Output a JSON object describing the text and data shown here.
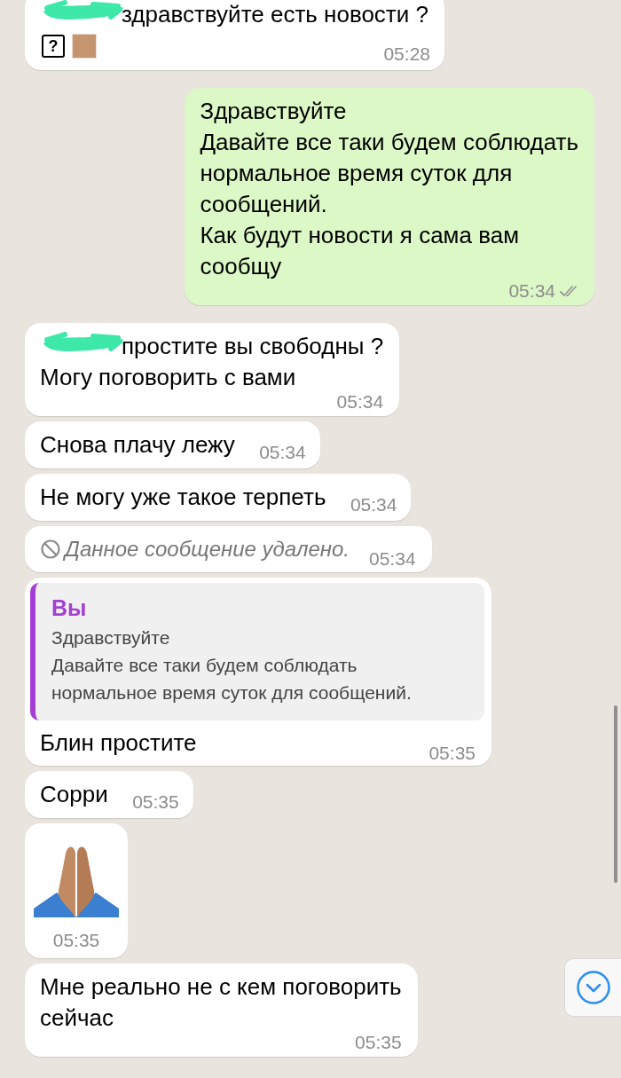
{
  "messages": [
    {
      "kind": "text",
      "outgoing": false,
      "redacted_name": true,
      "text": "здравствуйте есть новости ?",
      "attachments": [
        {
          "kind": "unknown-glyph",
          "text": "?"
        },
        {
          "kind": "tone-swatch"
        }
      ],
      "time": "05:28"
    },
    {
      "kind": "text",
      "outgoing": true,
      "text": "Здравствуйте\nДавайте все таки будем соблюдать\nнормальное время суток для\nсообщений.\nКак будут новости я сама вам\nсообщу",
      "time": "05:34",
      "read": false
    },
    {
      "kind": "text",
      "outgoing": false,
      "redacted_name": true,
      "text": "простите вы свободны ?\nМогу поговорить с вами",
      "time": "05:34"
    },
    {
      "kind": "text",
      "outgoing": false,
      "text": "Снова плачу лежу",
      "time": "05:34"
    },
    {
      "kind": "text",
      "outgoing": false,
      "text": "Не могу уже такое терпеть",
      "time": "05:34"
    },
    {
      "kind": "deleted",
      "outgoing": false,
      "text": "Данное сообщение удалено.",
      "time": "05:34"
    },
    {
      "kind": "reply",
      "outgoing": false,
      "quote": {
        "author": "Вы",
        "text": "Здравствуйте\nДавайте все таки будем соблюдать\nнормальное время суток для сообщений."
      },
      "text": "Блин простите",
      "time": "05:35"
    },
    {
      "kind": "text",
      "outgoing": false,
      "text": "Сорри",
      "time": "05:35"
    },
    {
      "kind": "emoji",
      "outgoing": false,
      "time": "05:35"
    },
    {
      "kind": "text",
      "outgoing": false,
      "text": "Мне реально не с кем поговорить\nсейчас",
      "time": "05:35"
    }
  ]
}
